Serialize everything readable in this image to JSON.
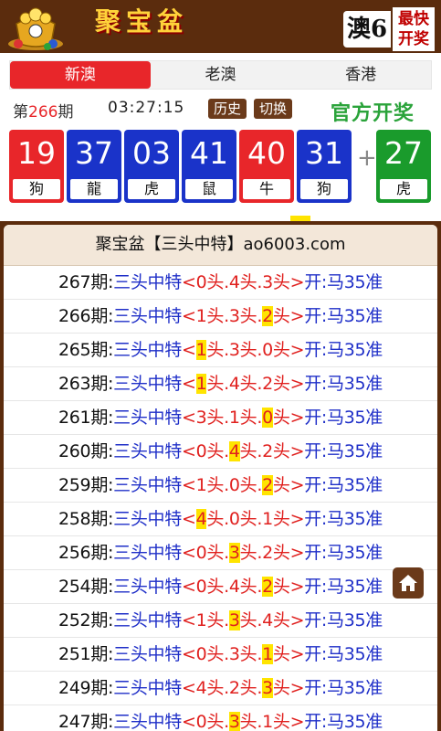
{
  "header": {
    "brand": "聚宝盆",
    "region_label": "澳6",
    "badge": [
      "最快",
      "开奖"
    ],
    "colors": {
      "bar": "#5b2c0d",
      "brand_text": "#ffd23a"
    }
  },
  "tabs": [
    {
      "label": "新澳",
      "active": true
    },
    {
      "label": "老澳",
      "active": false
    },
    {
      "label": "香港",
      "active": false
    }
  ],
  "draw": {
    "period_prefix": "第",
    "period_number": "266",
    "period_suffix": "期",
    "time": "03:27:15",
    "history_label": "历史",
    "switch_label": "切换",
    "official_label": "官方开奖",
    "balls": [
      {
        "number": "19",
        "zodiac": "狗",
        "color": "red"
      },
      {
        "number": "37",
        "zodiac": "龍",
        "color": "blue"
      },
      {
        "number": "03",
        "zodiac": "虎",
        "color": "blue"
      },
      {
        "number": "41",
        "zodiac": "鼠",
        "color": "blue"
      },
      {
        "number": "40",
        "zodiac": "牛",
        "color": "red"
      },
      {
        "number": "31",
        "zodiac": "狗",
        "color": "blue"
      }
    ],
    "plus": "+",
    "special": {
      "number": "27",
      "zodiac": "虎",
      "color": "green"
    }
  },
  "list": {
    "title": "聚宝盆【三头中特】ao6003.com",
    "rows": [
      {
        "period": "267期:",
        "label": "三头中特",
        "segs": [
          "0头",
          "4头",
          "3头"
        ],
        "hit": -1,
        "result": "开:马35准"
      },
      {
        "period": "266期:",
        "label": "三头中特",
        "segs": [
          "1头",
          "3头",
          "2头"
        ],
        "hit": 2,
        "result": "开:马35准"
      },
      {
        "period": "265期:",
        "label": "三头中特",
        "segs": [
          "1头",
          "3头",
          "0头"
        ],
        "hit": 0,
        "result": "开:马35准"
      },
      {
        "period": "263期:",
        "label": "三头中特",
        "segs": [
          "1头",
          "4头",
          "2头"
        ],
        "hit": 0,
        "result": "开:马35准"
      },
      {
        "period": "261期:",
        "label": "三头中特",
        "segs": [
          "3头",
          "1头",
          "0头"
        ],
        "hit": 2,
        "result": "开:马35准"
      },
      {
        "period": "260期:",
        "label": "三头中特",
        "segs": [
          "0头",
          "4头",
          "2头"
        ],
        "hit": 1,
        "result": "开:马35准"
      },
      {
        "period": "259期:",
        "label": "三头中特",
        "segs": [
          "1头",
          "0头",
          "2头"
        ],
        "hit": 2,
        "result": "开:马35准"
      },
      {
        "period": "258期:",
        "label": "三头中特",
        "segs": [
          "4头",
          "0头",
          "1头"
        ],
        "hit": 0,
        "result": "开:马35准"
      },
      {
        "period": "256期:",
        "label": "三头中特",
        "segs": [
          "0头",
          "3头",
          "2头"
        ],
        "hit": 1,
        "result": "开:马35准"
      },
      {
        "period": "254期:",
        "label": "三头中特",
        "segs": [
          "0头",
          "4头",
          "2头"
        ],
        "hit": 2,
        "result": "开:马35准"
      },
      {
        "period": "252期:",
        "label": "三头中特",
        "segs": [
          "1头",
          "3头",
          "4头"
        ],
        "hit": 1,
        "result": "开:马35准"
      },
      {
        "period": "251期:",
        "label": "三头中特",
        "segs": [
          "0头",
          "3头",
          "1头"
        ],
        "hit": 2,
        "result": "开:马35准"
      },
      {
        "period": "249期:",
        "label": "三头中特",
        "segs": [
          "4头",
          "2头",
          "3头"
        ],
        "hit": 2,
        "result": "开:马35准"
      },
      {
        "period": "247期:",
        "label": "三头中特",
        "segs": [
          "0头",
          "3头",
          "1头"
        ],
        "hit": 1,
        "result": "开:马35准"
      }
    ],
    "open_bracket": "<",
    "close_bracket": ">",
    "separator": "."
  },
  "floating": {
    "icon": "home-icon"
  },
  "ball_colors": {
    "red": "#e8262a",
    "blue": "#1a33c9",
    "green": "#1a9b2c"
  }
}
